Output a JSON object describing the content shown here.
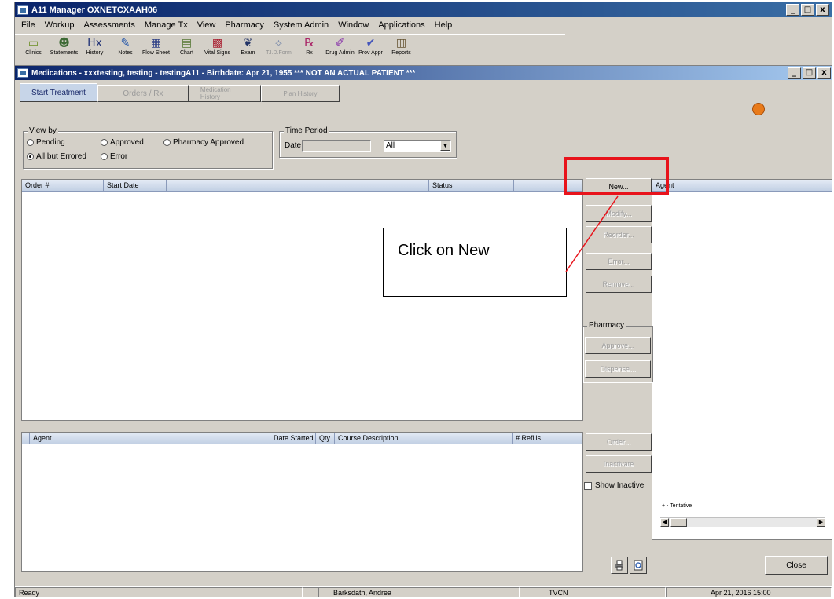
{
  "app": {
    "title": "A11 Manager OXNETCXAAH06",
    "window_buttons": [
      "_",
      "□",
      "x"
    ]
  },
  "menu": [
    "File",
    "Workup",
    "Assessments",
    "Manage Tx",
    "View",
    "Pharmacy",
    "System Admin",
    "Window",
    "Applications",
    "Help"
  ],
  "toolbar": [
    {
      "label": "Clinics",
      "icon": "folder-icon",
      "glyph": "▭",
      "color": "#6b8e23",
      "enabled": true
    },
    {
      "label": "Statements",
      "icon": "person-icon",
      "glyph": "☻",
      "color": "#3d6a35",
      "enabled": true
    },
    {
      "label": "History",
      "icon": "hx-icon",
      "glyph": "Hx",
      "color": "#223377",
      "enabled": true
    },
    {
      "label": "Notes",
      "icon": "notes-icon",
      "glyph": "✎",
      "color": "#2255aa",
      "enabled": true
    },
    {
      "label": "Flow Sheet",
      "icon": "grid-icon",
      "glyph": "▦",
      "color": "#334488",
      "enabled": true
    },
    {
      "label": "Chart",
      "icon": "chart-icon",
      "glyph": "▤",
      "color": "#557733",
      "enabled": true
    },
    {
      "label": "Vital Signs",
      "icon": "vitals-icon",
      "glyph": "▩",
      "color": "#aa2233",
      "enabled": true
    },
    {
      "label": "Exam",
      "icon": "stethoscope-icon",
      "glyph": "❦",
      "color": "#223366",
      "enabled": true
    },
    {
      "label": "T.I.D.Form",
      "icon": "tid-icon",
      "glyph": "⟡",
      "color": "#7788aa",
      "enabled": false
    },
    {
      "label": "Rx",
      "icon": "rx-icon",
      "glyph": "℞",
      "color": "#aa2266",
      "enabled": true
    },
    {
      "label": "Drug Admin",
      "icon": "drug-admin-icon",
      "glyph": "✐",
      "color": "#8833aa",
      "enabled": true
    },
    {
      "label": "Prov Appr",
      "icon": "prov-appr-icon",
      "glyph": "✔",
      "color": "#4455bb",
      "enabled": true
    },
    {
      "label": "Reports",
      "icon": "reports-icon",
      "glyph": "▥",
      "color": "#665533",
      "enabled": true
    }
  ],
  "child": {
    "title": "Medications - xxxtesting, testing - testingA11 - Birthdate: Apr 21, 1955 *** NOT AN ACTUAL PATIENT ***",
    "tabs": [
      "Start Treatment",
      "Orders / Rx",
      "Medication History",
      "Plan History"
    ],
    "view_by": {
      "legend": "View by",
      "options": [
        {
          "label": "Pending",
          "checked": false
        },
        {
          "label": "Approved",
          "checked": false
        },
        {
          "label": "Pharmacy Approved",
          "checked": false
        },
        {
          "label": "All but Errored",
          "checked": true
        },
        {
          "label": "Error",
          "checked": false
        }
      ]
    },
    "time_period": {
      "legend": "Time Period",
      "date_label": "Date",
      "date_value": "",
      "range_value": "All"
    },
    "orders_grid": {
      "headers": [
        "Order #",
        "Start Date",
        "",
        "Status",
        ""
      ]
    },
    "agent_grid": {
      "headers": [
        "Agent",
        "Date Started",
        "Qty",
        "Course Description",
        "# Refills"
      ]
    },
    "right_grid": {
      "header": "Agent",
      "legend_text": "+ - Tentative"
    },
    "buttons": {
      "new": "New...",
      "modify": "Modify...",
      "reorder": "Reorder...",
      "error": "Error...",
      "remove": "Remove...",
      "pharmacy_legend": "Pharmacy",
      "approve": "Approve...",
      "dispense": "Dispense...",
      "order": "Order...",
      "inactivate": "Inactivate",
      "show_inactive": "Show Inactive",
      "close": "Close"
    }
  },
  "status_bar": {
    "left": "Ready",
    "user": "Barksdath, Andrea",
    "site": "TVCN",
    "datetime": "Apr 21, 2016 15:00"
  },
  "annotation": {
    "text": "Click on New",
    "highlight_color": "#e8131b"
  }
}
